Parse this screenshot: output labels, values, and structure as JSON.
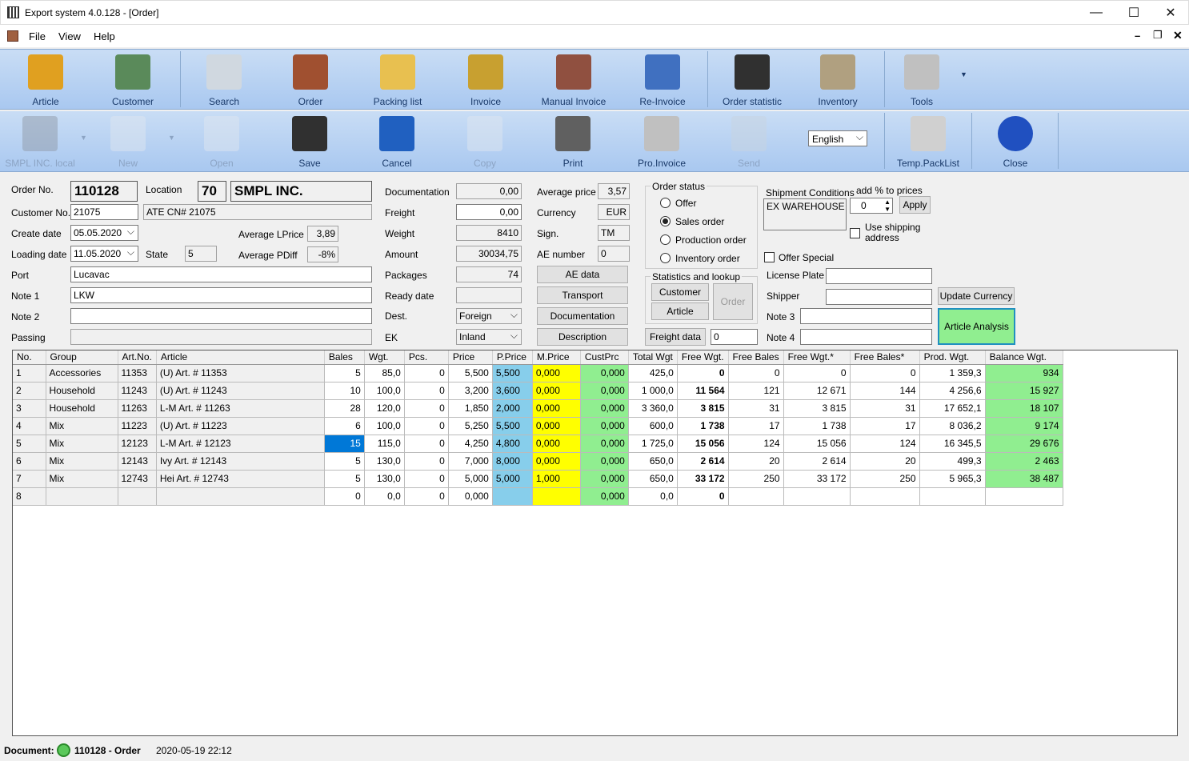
{
  "window": {
    "title": "Export system 4.0.128 - [Order]"
  },
  "menu": [
    "File",
    "View",
    "Help"
  ],
  "toolbar1": [
    {
      "label": "Article",
      "icon": "article-icon",
      "color": "#e0a020"
    },
    {
      "label": "Customer",
      "icon": "customer-icon",
      "color": "#5a8a5a"
    },
    {
      "label": "Search",
      "icon": "search-icon",
      "color": "#d0d8e0"
    },
    {
      "label": "Order",
      "icon": "order-icon",
      "color": "#a05030"
    },
    {
      "label": "Packing list",
      "icon": "packing-list-icon",
      "color": "#e8c050"
    },
    {
      "label": "Invoice",
      "icon": "invoice-icon",
      "color": "#c8a030"
    },
    {
      "label": "Manual Invoice",
      "icon": "manual-invoice-icon",
      "color": "#905040"
    },
    {
      "label": "Re-Invoice",
      "icon": "re-invoice-icon",
      "color": "#4070c0"
    },
    {
      "label": "Order statistic",
      "icon": "order-statistic-icon",
      "color": "#303030"
    },
    {
      "label": "Inventory",
      "icon": "inventory-icon",
      "color": "#b0a080"
    },
    {
      "label": "Tools",
      "icon": "tools-icon",
      "color": "#c0c0c0"
    }
  ],
  "toolbar2": [
    {
      "label": "SMPL INC. local",
      "icon": "database-icon",
      "disabled": true
    },
    {
      "label": "New",
      "icon": "new-document-icon",
      "disabled": true
    },
    {
      "label": "Open",
      "icon": "open-icon",
      "disabled": true
    },
    {
      "label": "Save",
      "icon": "save-icon",
      "disabled": false
    },
    {
      "label": "Cancel",
      "icon": "cancel-icon",
      "disabled": false
    },
    {
      "label": "Copy",
      "icon": "copy-icon",
      "disabled": true
    },
    {
      "label": "Print",
      "icon": "print-icon",
      "disabled": false
    },
    {
      "label": "Pro.Invoice",
      "icon": "pro-invoice-icon",
      "disabled": false
    },
    {
      "label": "Send",
      "icon": "send-icon",
      "disabled": true
    },
    {
      "label": "Temp.PackList",
      "icon": "temp-packlist-icon",
      "disabled": false
    },
    {
      "label": "Close",
      "icon": "close-arrow-icon",
      "disabled": false
    }
  ],
  "language": "English",
  "form": {
    "order_no_label": "Order No.",
    "order_no": "110128",
    "location_label": "Location",
    "location": "70",
    "customer_name": "SMPL INC.",
    "customer_no_label": "Customer No.",
    "customer_no": "21075",
    "customer_ref": "ATE CN# 21075",
    "create_date_label": "Create date",
    "create_date": "05.05.2020",
    "avg_lprice_label": "Average LPrice",
    "avg_lprice": "3,89",
    "loading_date_label": "Loading date",
    "loading_date": "11.05.2020",
    "state_label": "State",
    "state": "5",
    "avg_pdiff_label": "Average PDiff",
    "avg_pdiff": "-8%",
    "port_label": "Port",
    "port": "Lucavac",
    "note1_label": "Note 1",
    "note1": "LKW",
    "note2_label": "Note 2",
    "note2": "",
    "passing_label": "Passing",
    "passing": "",
    "documentation_label": "Documentation",
    "documentation": "0,00",
    "freight_label": "Freight",
    "freight": "0,00",
    "weight_label": "Weight",
    "weight": "8410",
    "amount_label": "Amount",
    "amount": "30034,75",
    "packages_label": "Packages",
    "packages": "74",
    "ready_date_label": "Ready date",
    "ready_date": "",
    "dest_label": "Dest.",
    "dest": "Foreign",
    "ek_label": "EK",
    "ek": "Inland",
    "avg_price_label": "Average price",
    "avg_price": "3,57",
    "currency_label": "Currency",
    "currency": "EUR",
    "sign_label": "Sign.",
    "sign": "TM",
    "ae_number_label": "AE number",
    "ae_number": "0",
    "ae_data_btn": "AE data",
    "transport_btn": "Transport",
    "documentation_btn": "Documentation",
    "description_btn": "Description",
    "order_status_label": "Order status",
    "statuses": [
      {
        "label": "Offer",
        "on": false
      },
      {
        "label": "Sales order",
        "on": true
      },
      {
        "label": "Production order",
        "on": false
      },
      {
        "label": "Inventory order",
        "on": false
      }
    ],
    "stats_label": "Statistics and lookup",
    "stats_customer_btn": "Customer",
    "stats_article_btn": "Article",
    "stats_order_btn": "Order",
    "freight_data_btn": "Freight data",
    "freight_data": "0",
    "shipment_label": "Shipment Conditions",
    "shipment": "EX WAREHOUSE",
    "add_pct_label": "add % to prices",
    "add_pct": "0",
    "apply_btn": "Apply",
    "use_shipping_label": "Use shipping address",
    "offer_special_label": "Offer Special",
    "license_plate_label": "License Plate",
    "license_plate": "",
    "shipper_label": "Shipper",
    "shipper": "",
    "note3_label": "Note 3",
    "note3": "",
    "note4_label": "Note 4",
    "note4": "",
    "update_currency_btn": "Update Currency",
    "article_analysis_btn": "Article Analysis"
  },
  "table": {
    "headers": [
      "No.",
      "Group",
      "Art.No.",
      "Article",
      "Bales",
      "Wgt.",
      "Pcs.",
      "Price",
      "P.Price",
      "M.Price",
      "CustPrc",
      "Total Wgt",
      "Free Wgt.",
      "Free Bales",
      "Free Wgt.*",
      "Free Bales*",
      "Prod. Wgt.",
      "Balance Wgt."
    ],
    "rows": [
      [
        "1",
        "Accessories",
        "11353",
        "(U) Art. # 11353",
        "5",
        "85,0",
        "0",
        "5,500",
        "5,500",
        "0,000",
        "0,000",
        "425,0",
        "0",
        "0",
        "0",
        "0",
        "1 359,3",
        "934"
      ],
      [
        "2",
        "Household",
        "11243",
        "(U) Art. # 11243",
        "10",
        "100,0",
        "0",
        "3,200",
        "3,600",
        "0,000",
        "0,000",
        "1 000,0",
        "11 564",
        "121",
        "12 671",
        "144",
        "4 256,6",
        "15 927"
      ],
      [
        "3",
        "Household",
        "11263",
        "L-M Art. # 11263",
        "28",
        "120,0",
        "0",
        "1,850",
        "2,000",
        "0,000",
        "0,000",
        "3 360,0",
        "3 815",
        "31",
        "3 815",
        "31",
        "17 652,1",
        "18 107"
      ],
      [
        "4",
        "Mix",
        "11223",
        "(U) Art. # 11223",
        "6",
        "100,0",
        "0",
        "5,250",
        "5,500",
        "0,000",
        "0,000",
        "600,0",
        "1 738",
        "17",
        "1 738",
        "17",
        "8 036,2",
        "9 174"
      ],
      [
        "5",
        "Mix",
        "12123",
        "L-M Art. # 12123",
        "15",
        "115,0",
        "0",
        "4,250",
        "4,800",
        "0,000",
        "0,000",
        "1 725,0",
        "15 056",
        "124",
        "15 056",
        "124",
        "16 345,5",
        "29 676"
      ],
      [
        "6",
        "Mix",
        "12143",
        "Ivy Art. # 12143",
        "5",
        "130,0",
        "0",
        "7,000",
        "8,000",
        "0,000",
        "0,000",
        "650,0",
        "2 614",
        "20",
        "2 614",
        "20",
        "499,3",
        "2 463"
      ],
      [
        "7",
        "Mix",
        "12743",
        "Hei Art. # 12743",
        "5",
        "130,0",
        "0",
        "5,000",
        "5,000",
        "1,000",
        "0,000",
        "650,0",
        "33 172",
        "250",
        "33 172",
        "250",
        "5 965,3",
        "38 487"
      ],
      [
        "8",
        "",
        "",
        "",
        "0",
        "0,0",
        "0",
        "0,000",
        "",
        "",
        "0,000",
        "0,0",
        "0",
        "",
        "",
        "",
        "",
        ""
      ]
    ]
  },
  "status": {
    "doc_label": "Document:",
    "doc_value": "110128 - Order",
    "timestamp": "2020-05-19 22:12"
  }
}
